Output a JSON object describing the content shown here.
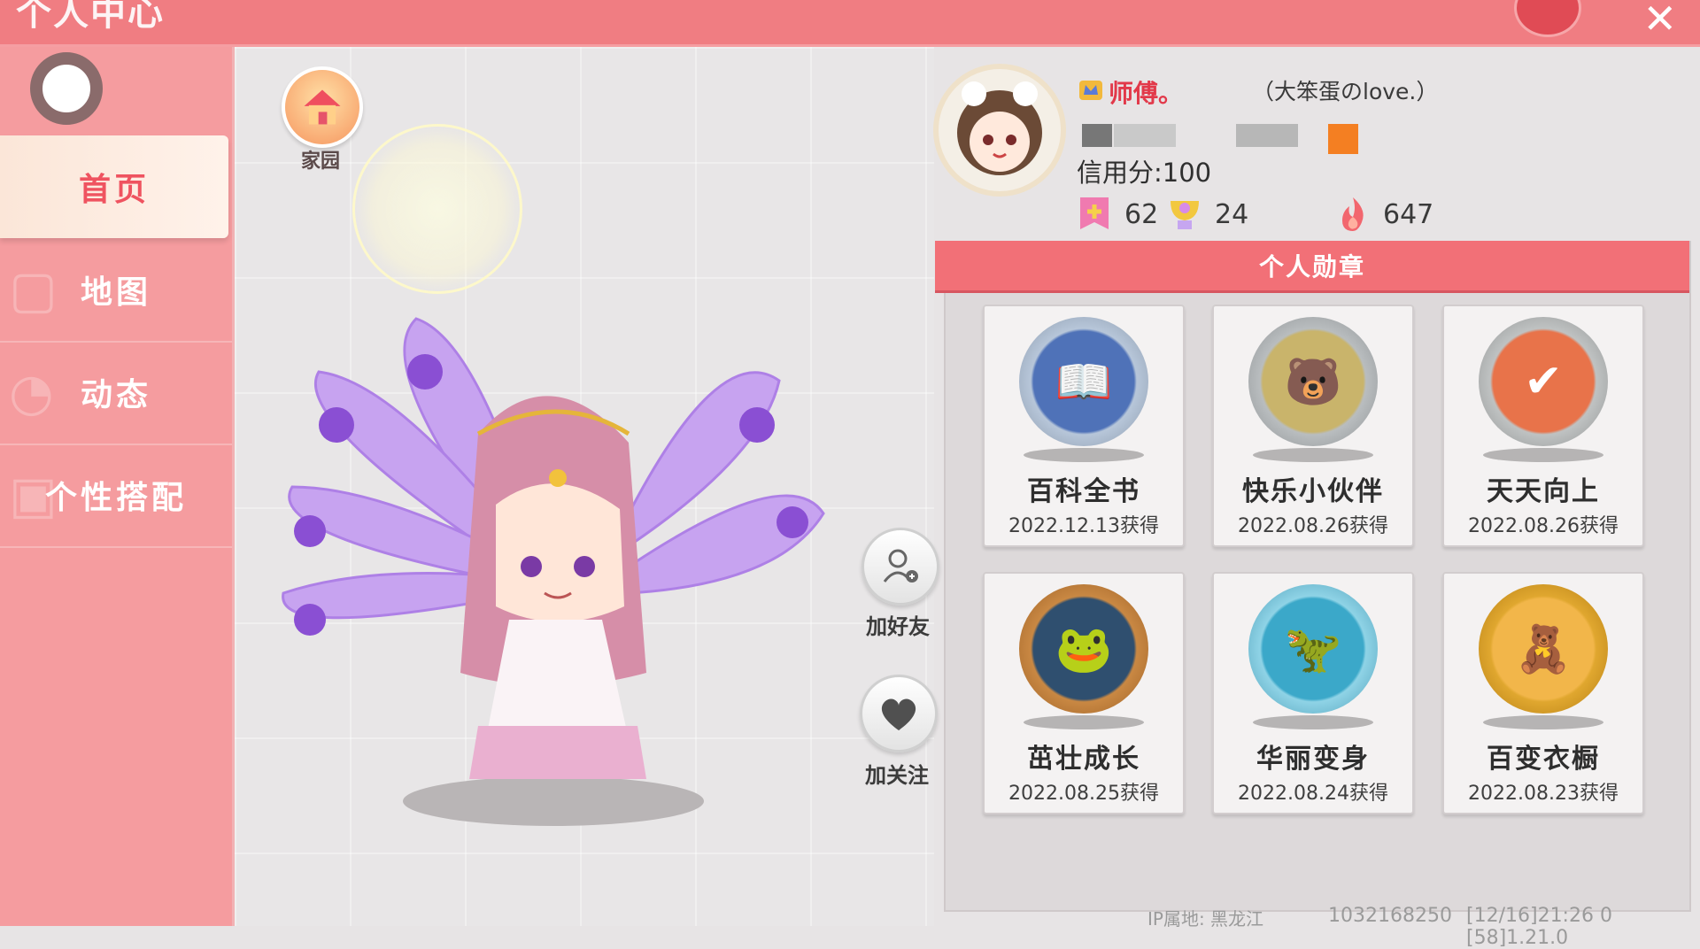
{
  "header": {
    "title": "个人中心",
    "close_icon": "close-icon"
  },
  "sidebar": {
    "items": [
      {
        "label": "首页",
        "active": true
      },
      {
        "label": "地图",
        "active": false
      },
      {
        "label": "动态",
        "active": false
      },
      {
        "label": "个性搭配",
        "active": false
      }
    ]
  },
  "stage": {
    "home_label": "家园",
    "add_friend_label": "加好友",
    "follow_label": "加关注"
  },
  "profile": {
    "name": "师傅。",
    "nickname": "（大笨蛋のlove.）",
    "credit": "信用分:100",
    "stats": [
      {
        "icon": "badge-plus-icon",
        "value": "62"
      },
      {
        "icon": "trophy-icon",
        "value": "24"
      },
      {
        "icon": "fire-icon",
        "value": "647"
      }
    ]
  },
  "medals": {
    "header": "个人勋章",
    "items": [
      {
        "name": "百科全书",
        "date": "2022.12.13获得",
        "color": "#4f72b8",
        "ring": "#b7c6d9"
      },
      {
        "name": "快乐小伙伴",
        "date": "2022.08.26获得",
        "color": "#c9b46b",
        "ring": "#b9bdbf"
      },
      {
        "name": "天天向上",
        "date": "2022.08.26获得",
        "color": "#e8734a",
        "ring": "#bfc2c2"
      },
      {
        "name": "茁壮成长",
        "date": "2022.08.25获得",
        "color": "#2f4f6f",
        "ring": "#c98843"
      },
      {
        "name": "华丽变身",
        "date": "2022.08.24获得",
        "color": "#3ba8c9",
        "ring": "#8fd3e6"
      },
      {
        "name": "百变衣橱",
        "date": "2022.08.23获得",
        "color": "#f2b64a",
        "ring": "#e0a72f"
      }
    ]
  },
  "footer": {
    "ip": "IP属地: 黑龙江",
    "id": "1032168250",
    "version": "[12/16]21:26 0  [58]1.21.0"
  }
}
